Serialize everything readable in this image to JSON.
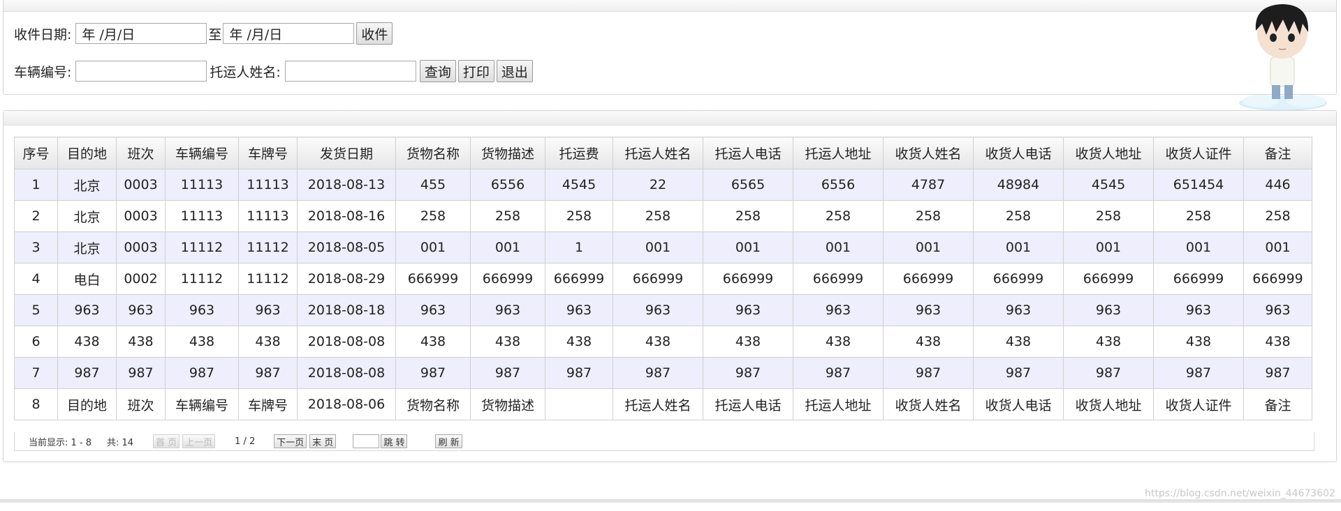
{
  "search": {
    "receive_date_label": "收件日期:",
    "date_from": "年 /月/日",
    "date_sep": "至",
    "date_to": "年 /月/日",
    "receive_button": "收件",
    "vehicle_label": "车辆编号:",
    "vehicle_value": "",
    "shipper_label": "托运人姓名:",
    "shipper_value": "",
    "query_button": "查询",
    "print_button": "打印",
    "exit_button": "退出"
  },
  "table": {
    "columns": [
      "序号",
      "目的地",
      "班次",
      "车辆编号",
      "车牌号",
      "发货日期",
      "货物名称",
      "货物描述",
      "托运费",
      "托运人姓名",
      "托运人电话",
      "托运人地址",
      "收货人姓名",
      "收货人电话",
      "收货人地址",
      "收货人证件",
      "备注"
    ],
    "rows": [
      [
        "1",
        "北京",
        "0003",
        "11113",
        "11113",
        "2018-08-13",
        "455",
        "6556",
        "4545",
        "22",
        "6565",
        "6556",
        "4787",
        "48984",
        "4545",
        "651454",
        "446"
      ],
      [
        "2",
        "北京",
        "0003",
        "11113",
        "11113",
        "2018-08-16",
        "258",
        "258",
        "258",
        "258",
        "258",
        "258",
        "258",
        "258",
        "258",
        "258",
        "258"
      ],
      [
        "3",
        "北京",
        "0003",
        "11112",
        "11112",
        "2018-08-05",
        "001",
        "001",
        "1",
        "001",
        "001",
        "001",
        "001",
        "001",
        "001",
        "001",
        "001"
      ],
      [
        "4",
        "电白",
        "0002",
        "11112",
        "11112",
        "2018-08-29",
        "666999",
        "666999",
        "666999",
        "666999",
        "666999",
        "666999",
        "666999",
        "666999",
        "666999",
        "666999",
        "666999"
      ],
      [
        "5",
        "963",
        "963",
        "963",
        "963",
        "2018-08-18",
        "963",
        "963",
        "963",
        "963",
        "963",
        "963",
        "963",
        "963",
        "963",
        "963",
        "963"
      ],
      [
        "6",
        "438",
        "438",
        "438",
        "438",
        "2018-08-08",
        "438",
        "438",
        "438",
        "438",
        "438",
        "438",
        "438",
        "438",
        "438",
        "438",
        "438"
      ],
      [
        "7",
        "987",
        "987",
        "987",
        "987",
        "2018-08-08",
        "987",
        "987",
        "987",
        "987",
        "987",
        "987",
        "987",
        "987",
        "987",
        "987",
        "987"
      ],
      [
        "8",
        "目的地",
        "班次",
        "车辆编号",
        "车牌号",
        "2018-08-06",
        "货物名称",
        "货物描述",
        "",
        "托运人姓名",
        "托运人电话",
        "托运人地址",
        "收货人姓名",
        "收货人电话",
        "收货人地址",
        "收货人证件",
        "备注"
      ]
    ]
  },
  "pager": {
    "showing": "当前显示: 1 - 8",
    "total": "共: 14",
    "first": "首 页",
    "prev": "上一页",
    "page_info": "1 / 2",
    "next": "下一页",
    "last": "末 页",
    "jump_value": "",
    "jump": "跳 转",
    "refresh": "刷 新"
  },
  "watermark": "https://blog.csdn.net/weixin_44673602"
}
